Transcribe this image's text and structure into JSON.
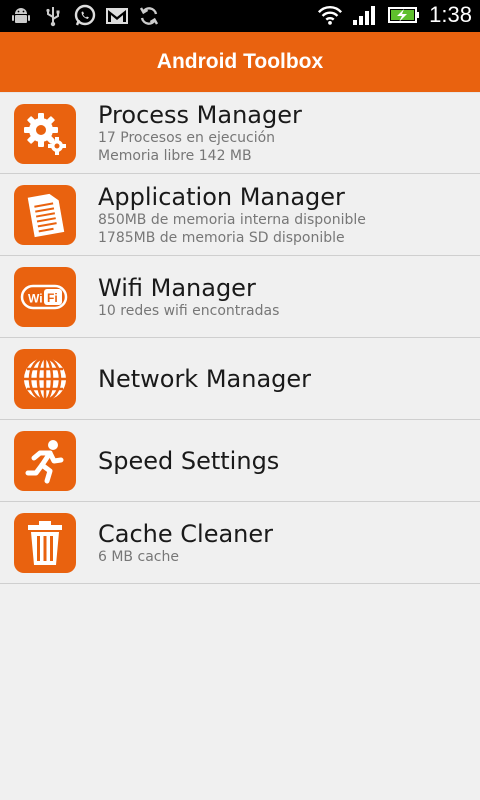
{
  "colors": {
    "accent": "#e9620f",
    "background": "#f0f0f0",
    "statusbar": "#000000"
  },
  "statusbar": {
    "left_icons": [
      "android-debug-icon",
      "usb-icon",
      "whatsapp-icon",
      "gmail-icon",
      "sync-icon"
    ],
    "right_icons": [
      "wifi-icon",
      "signal-icon",
      "battery-charging-icon"
    ],
    "time": "1:38"
  },
  "app": {
    "title": "Android Toolbox"
  },
  "items": [
    {
      "icon": "gear-icon",
      "title": "Process Manager",
      "lines": [
        "17 Procesos en ejecución",
        "Memoria libre 142 MB"
      ]
    },
    {
      "icon": "document-icon",
      "title": "Application Manager",
      "lines": [
        "850MB de memoria interna disponible",
        "1785MB de memoria SD disponible"
      ]
    },
    {
      "icon": "wifi-logo-icon",
      "title": "Wifi Manager",
      "lines": [
        "10 redes wifi encontradas"
      ]
    },
    {
      "icon": "globe-icon",
      "title": "Network Manager",
      "lines": []
    },
    {
      "icon": "runner-icon",
      "title": "Speed Settings",
      "lines": []
    },
    {
      "icon": "trash-icon",
      "title": "Cache Cleaner",
      "lines": [
        "6 MB cache"
      ]
    }
  ]
}
